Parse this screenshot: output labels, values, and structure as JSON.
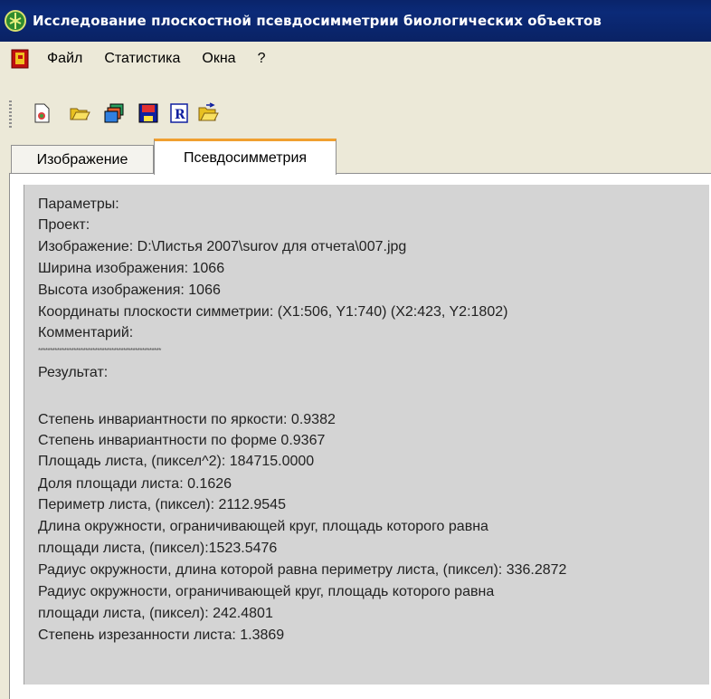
{
  "window": {
    "title": "Исследование плоскостной псевдосимметрии биологических объектов"
  },
  "menu": [
    "Файл",
    "Статистика",
    "Окна",
    "?"
  ],
  "toolbar": {
    "buttons": [
      "new-document-icon",
      "open-folder-icon",
      "windows-icon",
      "save-disk-icon",
      "report-r-icon",
      "folder-export-icon"
    ]
  },
  "tabs": [
    {
      "label": "Изображение",
      "active": false
    },
    {
      "label": "Псевдосимметрия",
      "active": true
    }
  ],
  "report": {
    "params": "Параметры:",
    "project": "Проект:",
    "image_path": "Изображение: D:\\Листья 2007\\surov для отчета\\007.jpg",
    "width": "Ширина изображения: 1066",
    "height": "Высота изображения: 1066",
    "coords": "Координаты плоскости симметрии: (X1:506, Y1:740) (X2:423, Y2:1802)",
    "comment": "Комментарий:",
    "separator": "****************************************************",
    "result": "Результат:",
    "brightness": "Степень инвариантности по яркости: 0.9382",
    "shape": "Степень инвариантности по форме  0.9367",
    "area": "Площадь листа, (пиксел^2): 184715.0000",
    "area_share": "Доля площади листа: 0.1626",
    "perimeter": "Периметр листа, (пиксел): 2112.9545",
    "circle_len_1": "Длина   окружности, ограничивающей круг, площадь которого равна",
    "circle_len_2": "площади листа, (пиксел):1523.5476",
    "radius_perim": "Радиус окружности, длина которой равна периметру листа, (пиксел): 336.2872",
    "radius_area_1": "Радиус окружности, ограничивающей круг, площадь которого равна",
    "radius_area_2": "площади листа, (пиксел):  242.4801",
    "dissection": "Степень изрезанности листа: 1.3869"
  }
}
